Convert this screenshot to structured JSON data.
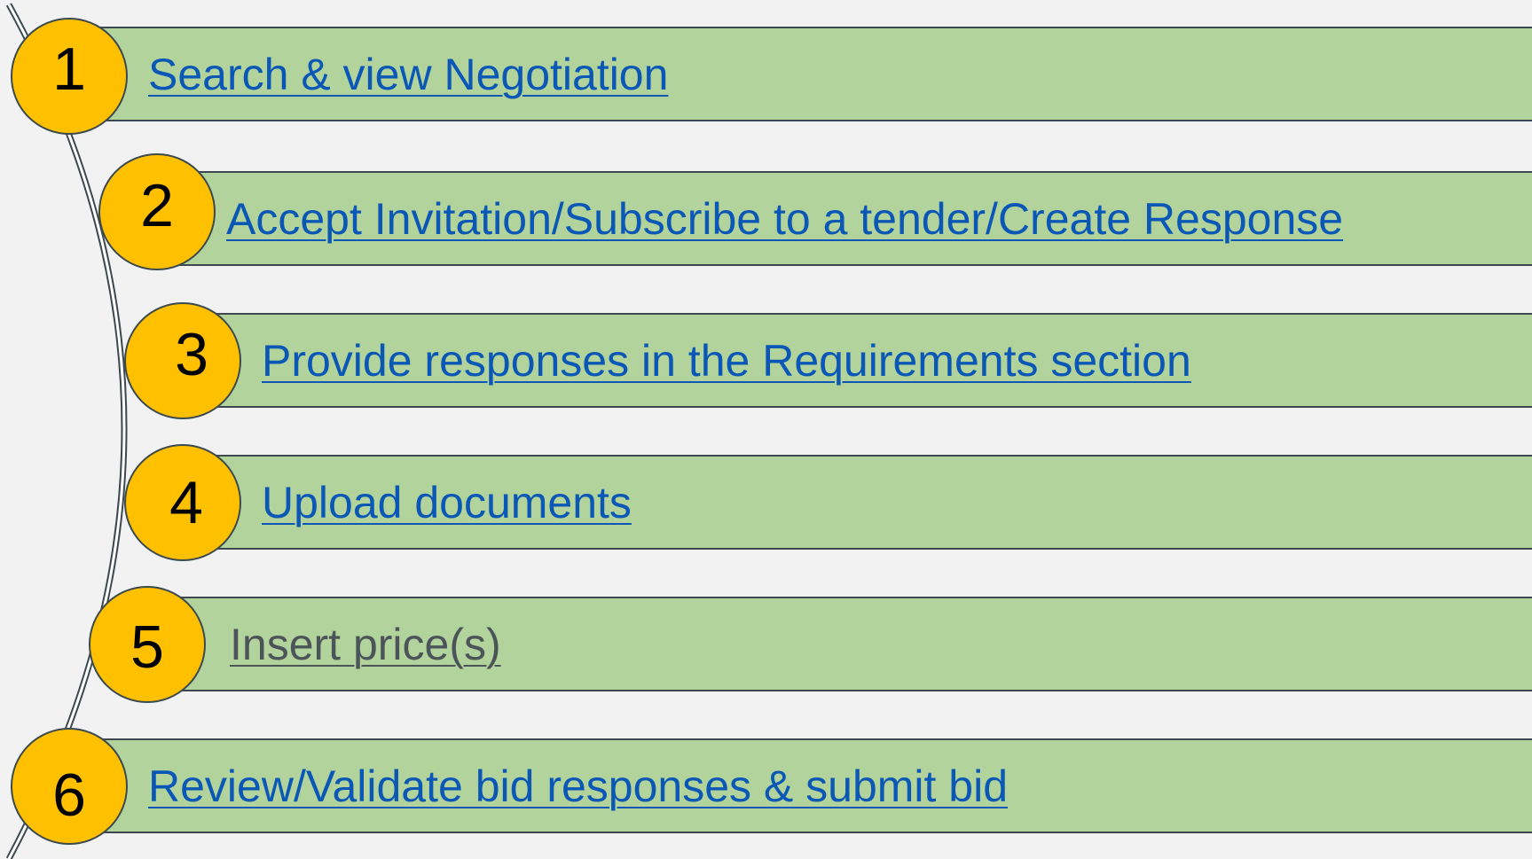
{
  "colors": {
    "bar_fill": "#b2d39c",
    "outline": "#3c4a4f",
    "circle_fill": "#ffc000",
    "link": "#0b57b5",
    "visited": "#4b5559",
    "background": "#f2f2f2"
  },
  "steps": [
    {
      "number": "1",
      "label": "Search & view Negotiation",
      "style": "link"
    },
    {
      "number": "2",
      "label": "Accept Invitation/Subscribe to a tender/Create Response",
      "style": "link"
    },
    {
      "number": "3",
      "label": "Provide responses in the Requirements section",
      "style": "link"
    },
    {
      "number": "4",
      "label": "Upload documents",
      "style": "link"
    },
    {
      "number": "5",
      "label": "Insert price(s)",
      "style": "visited"
    },
    {
      "number": "6",
      "label": "Review/Validate bid responses & submit bid",
      "style": "link"
    }
  ]
}
